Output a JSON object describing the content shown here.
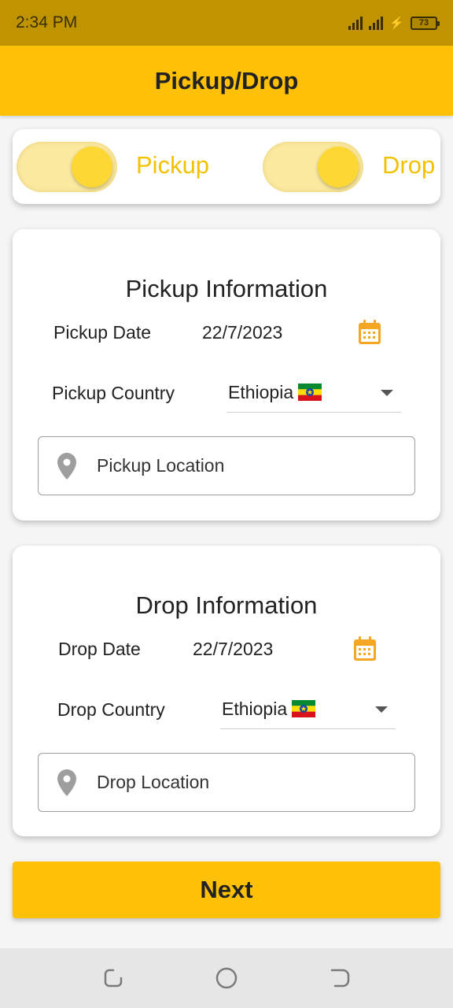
{
  "status_bar": {
    "time": "2:34 PM",
    "battery": "73"
  },
  "app_bar": {
    "title": "Pickup/Drop"
  },
  "toggles": {
    "pickup_label": "Pickup",
    "drop_label": "Drop",
    "pickup_on": true,
    "drop_on": true
  },
  "pickup": {
    "title": "Pickup Information",
    "date_label": "Pickup Date",
    "date_value": "22/7/2023",
    "country_label": "Pickup Country",
    "country_value": "Ethiopia",
    "location_placeholder": "Pickup Location"
  },
  "drop": {
    "title": "Drop Information",
    "date_label": "Drop Date",
    "date_value": "22/7/2023",
    "country_label": "Drop Country",
    "country_value": "Ethiopia",
    "location_placeholder": "Drop Location"
  },
  "next_button": {
    "label": "Next"
  },
  "colors": {
    "accent": "#ffc107",
    "status_bar": "#bf9400",
    "toggle_label": "#f2c200",
    "calendar_icon": "#f5a623"
  },
  "icons": [
    "calendar-icon",
    "location-pin-icon",
    "dropdown-arrow-icon",
    "ethiopia-flag-icon",
    "recent-apps-icon",
    "home-icon",
    "back-icon"
  ]
}
